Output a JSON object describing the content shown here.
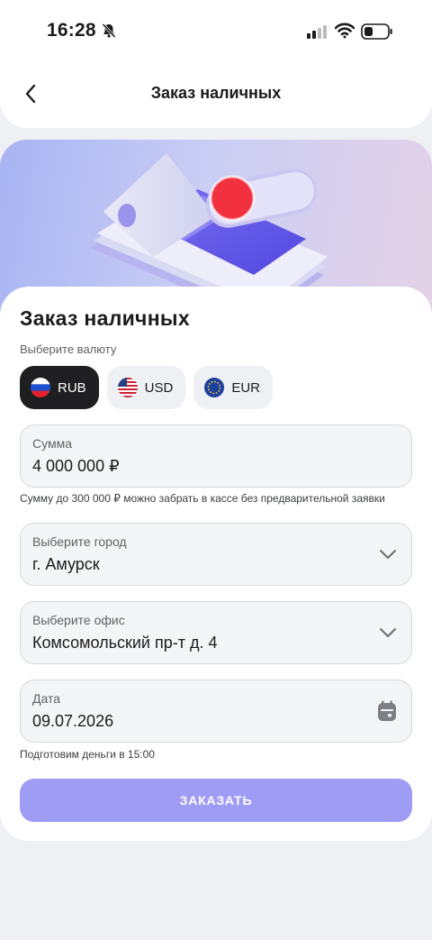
{
  "status_bar": {
    "time": "16:28"
  },
  "header": {
    "title": "Заказ наличных"
  },
  "card": {
    "title": "Заказ наличных",
    "currency_label": "Выберите валюту",
    "currencies": [
      {
        "code": "RUB",
        "active": true
      },
      {
        "code": "USD",
        "active": false
      },
      {
        "code": "EUR",
        "active": false
      }
    ]
  },
  "fields": {
    "amount": {
      "label": "Сумма",
      "value": "4 000 000 ₽",
      "hint": "Сумму до 300 000 ₽ можно забрать в кассе без предварительной заявки"
    },
    "city": {
      "label": "Выберите город",
      "value": "г. Амурск"
    },
    "office": {
      "label": "Выберите офис",
      "value": "Комсомольский пр-т д. 4"
    },
    "date": {
      "label": "Дата",
      "value": "09.07.2026",
      "hint": "Подготовим деньги в 15:00"
    }
  },
  "actions": {
    "order_label": "ЗАКАЗАТЬ"
  },
  "colors": {
    "accent": "#9e9cf4",
    "active_chip": "#1f1f21",
    "field_bg": "#f4f5f7",
    "page_bg": "#eef0f3"
  }
}
